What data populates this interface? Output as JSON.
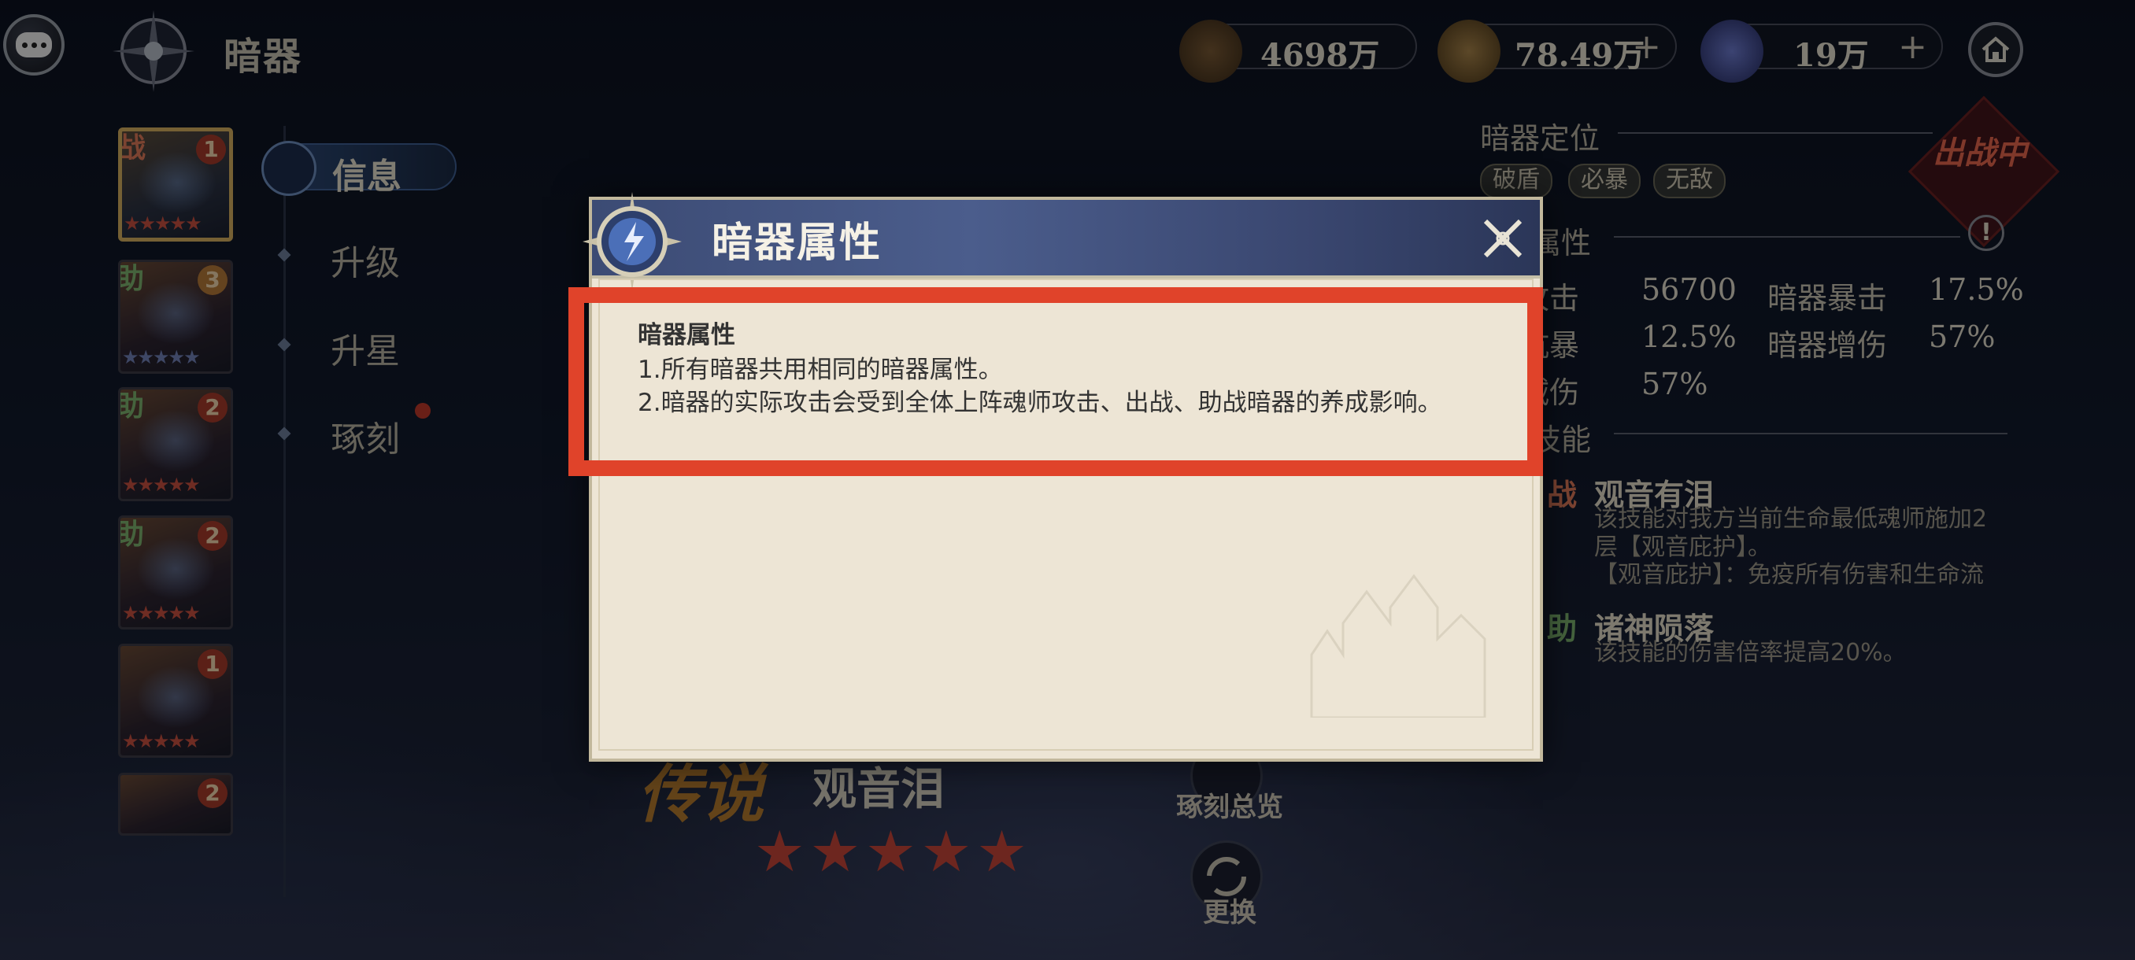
{
  "top_bar": {
    "title": "暗器",
    "resources": [
      {
        "icon": "hammer-coin-icon",
        "amount": "4698万",
        "has_plus": false
      },
      {
        "icon": "gold-coin-icon",
        "amount": "78.49万",
        "has_plus": true
      },
      {
        "icon": "diamond-icon",
        "amount": "19万",
        "has_plus": true
      }
    ]
  },
  "cards": [
    {
      "tag": "战",
      "level": "1",
      "stars": "★★★★★",
      "active": true
    },
    {
      "tag": "助",
      "level": "3",
      "stars": "★★★★★",
      "active": false
    },
    {
      "tag": "助",
      "level": "2",
      "stars": "★★★★★",
      "active": false
    },
    {
      "tag": "助",
      "level": "2",
      "stars": "★★★★★",
      "active": false
    },
    {
      "tag": "",
      "level": "1",
      "stars": "★★★★★",
      "active": false
    },
    {
      "tag": "",
      "level": "2",
      "stars": "",
      "active": false
    }
  ],
  "nav": {
    "info": "信息",
    "upgrade": "升级",
    "star": "升星",
    "engrave": "琢刻"
  },
  "right_panel": {
    "position_label": "暗器定位",
    "chips": [
      "破盾",
      "必暴",
      "无敌"
    ],
    "battle_status": "出战中",
    "attr_label": "属性",
    "stats": [
      {
        "k": "攻击",
        "v": "56700"
      },
      {
        "k": "暗器暴击",
        "v": "17.5%"
      },
      {
        "k": "抗暴",
        "v": "12.5%"
      },
      {
        "k": "暗器增伤",
        "v": "57%"
      },
      {
        "k": "减伤",
        "v": "57%"
      }
    ],
    "skill_label": "技能",
    "skills": [
      {
        "tag": "战",
        "name": "观音有泪",
        "desc1": "该技能对我方当前生命最低魂师施加2",
        "desc2": "层【观音庇护】。",
        "desc3": "【观音庇护】：免疫所有伤害和生命流"
      },
      {
        "tag": "助",
        "name": "诸神陨落",
        "desc1": "该技能的伤害倍率提高20%。"
      }
    ]
  },
  "bottom": {
    "rarity": "传说",
    "weapon_name": "观音泪",
    "stars": "★★★★★",
    "engrave_overview": "琢刻总览",
    "replace": "更换"
  },
  "modal": {
    "title": "暗器属性",
    "heading": "暗器属性",
    "line1": "1.所有暗器共用相同的暗器属性。",
    "line2": "2.暗器的实际攻击会受到全体上阵魂师攻击、出战、助战暗器的养成影响。"
  }
}
